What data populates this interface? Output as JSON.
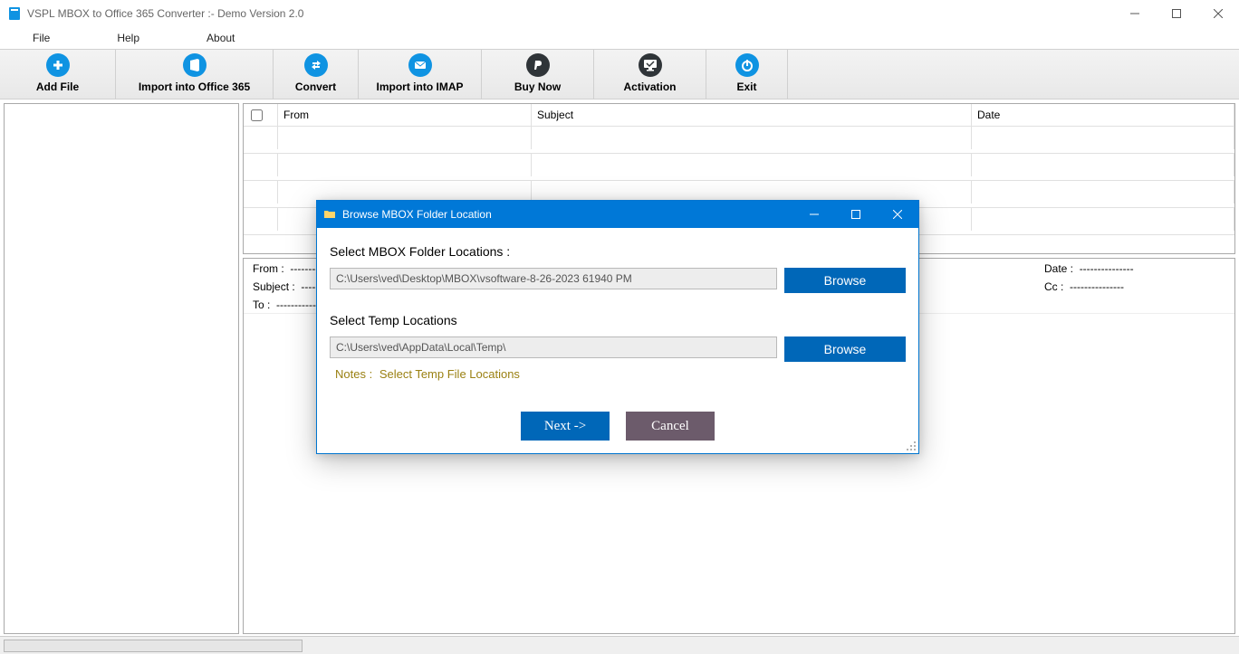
{
  "window": {
    "title": "VSPL MBOX to Office 365 Converter  :- Demo Version 2.0"
  },
  "menu": {
    "file": "File",
    "help": "Help",
    "about": "About"
  },
  "toolbar": {
    "add_file": "Add File",
    "import_o365": "Import into Office 365",
    "convert": "Convert",
    "import_imap": "Import into IMAP",
    "buy_now": "Buy Now",
    "activation": "Activation",
    "exit": "Exit"
  },
  "list": {
    "col_from": "From",
    "col_subject": "Subject",
    "col_date": "Date"
  },
  "preview": {
    "from_label": "From :",
    "subject_label": "Subject :",
    "to_label": "To :",
    "date_label": "Date :",
    "cc_label": "Cc :",
    "blank": "---------------"
  },
  "dialog": {
    "title": "Browse MBOX Folder Location",
    "select_mbox_label": "Select MBOX Folder Locations :",
    "mbox_path": "C:\\Users\\ved\\Desktop\\MBOX\\vsoftware-8-26-2023 61940 PM",
    "browse": "Browse",
    "select_temp_label": "Select Temp Locations",
    "temp_path": "C:\\Users\\ved\\AppData\\Local\\Temp\\",
    "notes_prefix": "Notes :",
    "notes_link": "Select Temp File Locations",
    "next": "Next  ->",
    "cancel": "Cancel"
  }
}
